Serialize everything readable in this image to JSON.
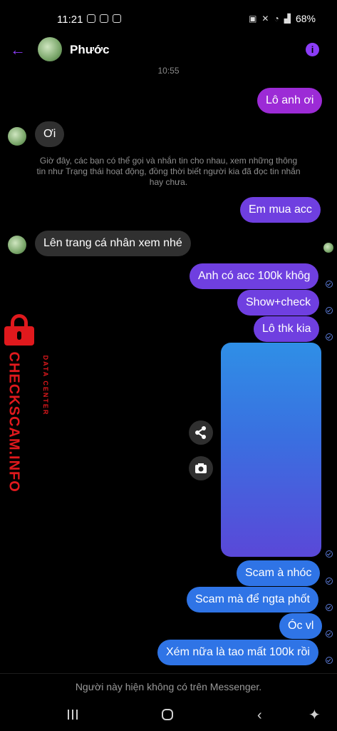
{
  "status_bar": {
    "time": "11:21",
    "battery": "68%"
  },
  "header": {
    "contact_name": "Phước"
  },
  "timestamp": "10:55",
  "messages": [
    {
      "text": "Lô anh ơi"
    },
    {
      "text": "Ơi"
    },
    {
      "text": "Em mua acc"
    },
    {
      "text": "Lên trang cá nhân xem nhé"
    },
    {
      "text": "Anh có acc 100k khôg"
    },
    {
      "text": "Show+check"
    },
    {
      "text": "Lô thk kia"
    },
    {
      "text": "Scam à nhóc"
    },
    {
      "text": "Scam mà để ngta phốt"
    },
    {
      "text": "Óc vl"
    },
    {
      "text": "Xém nữa là tao mất 100k rồi"
    }
  ],
  "system_notice": "Giờ đây, các bạn có thể gọi và nhắn tin cho nhau, xem những thông tin như Trạng thái hoạt động, đồng thời biết người kia đã đọc tin nhắn hay chưa.",
  "watermark": {
    "brand": "CHECKSCAM.INFO",
    "subtitle": "DATA CENTER"
  },
  "footer": {
    "text": "Người này hiện không có trên Messenger."
  },
  "colors": {
    "accent": "#8b3cf7",
    "bubble_blue": "#2f74e6",
    "bubble_purple": "#9c2bd6",
    "watermark_red": "#e0191d"
  }
}
